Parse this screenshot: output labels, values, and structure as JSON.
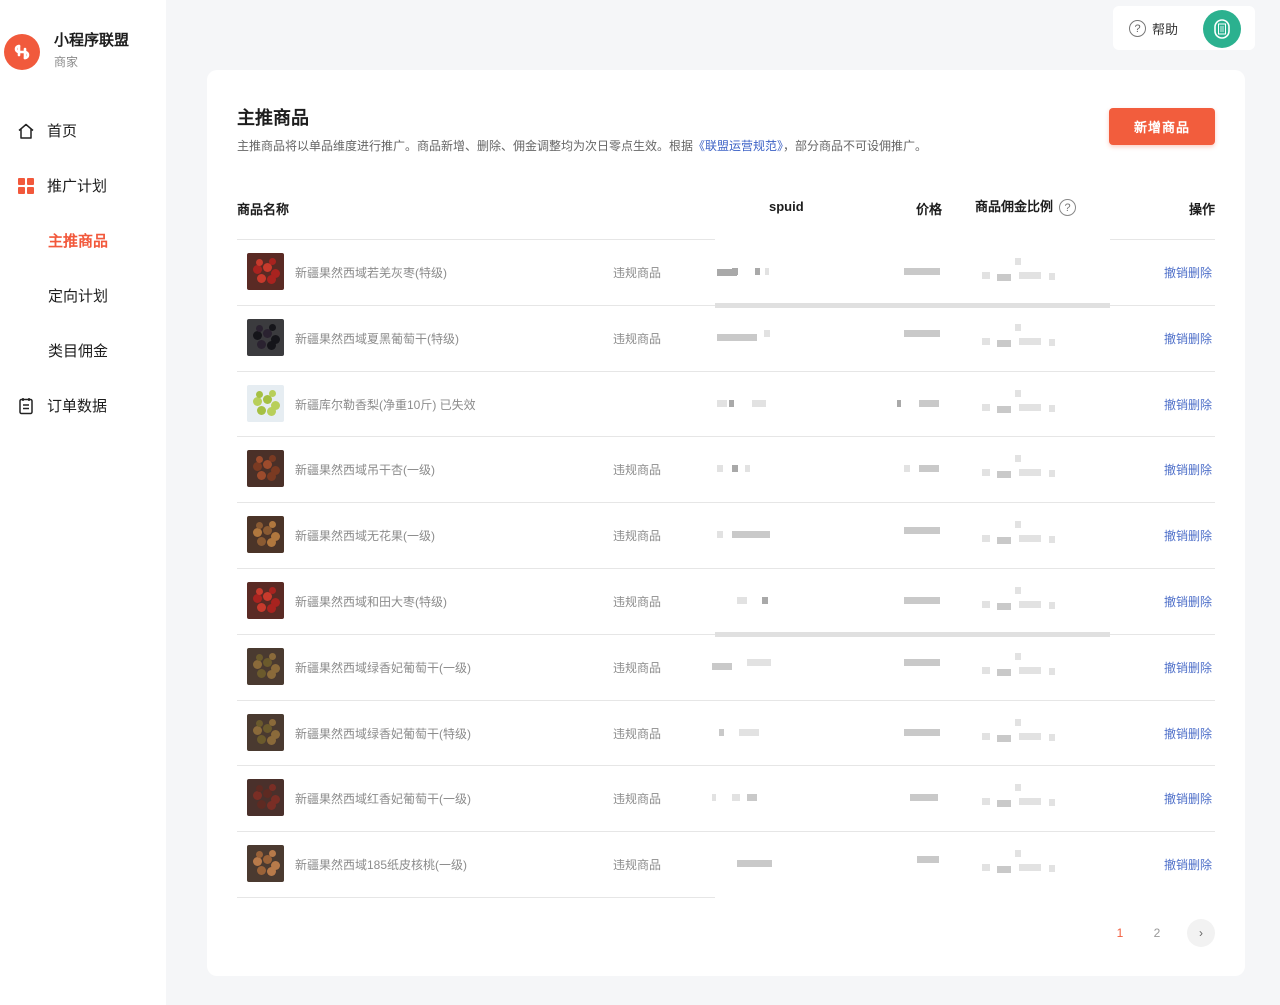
{
  "brand": {
    "name": "小程序联盟",
    "sub": "商家",
    "logo_color": "#f15a3c"
  },
  "nav": [
    {
      "label": "首页",
      "icon": "home-icon"
    },
    {
      "label": "推广计划",
      "icon": "grid-icon"
    },
    {
      "label": "主推商品",
      "active": true
    },
    {
      "label": "定向计划"
    },
    {
      "label": "类目佣金"
    },
    {
      "label": "订单数据",
      "icon": "document-icon"
    }
  ],
  "topbar": {
    "help_label": "帮助"
  },
  "page": {
    "title": "主推商品",
    "desc_before": "主推商品将以单品维度进行推广。商品新增、删除、佣金调整均为次日零点生效。根据",
    "desc_link": "《联盟运营规范》",
    "desc_after": "，部分商品不可设佣推广。",
    "add_button": "新增商品"
  },
  "table": {
    "headers": {
      "name": "商品名称",
      "spuid": "spuid",
      "price": "价格",
      "commission": "商品佣金比例",
      "action": "操作"
    },
    "rows": [
      {
        "name": "新疆果然西域若羌灰枣(特级)",
        "status": "违规商品",
        "action": "撤销删除",
        "thumb": "red-dates"
      },
      {
        "name": "新疆果然西域夏黑葡萄干(特级)",
        "status": "违规商品",
        "action": "撤销删除",
        "thumb": "black-raisins"
      },
      {
        "name": "新疆库尔勒香梨(净重10斤) 已失效",
        "status": "",
        "action": "撤销删除",
        "thumb": "pears"
      },
      {
        "name": "新疆果然西域吊干杏(一级)",
        "status": "违规商品",
        "action": "撤销删除",
        "thumb": "apricots"
      },
      {
        "name": "新疆果然西域无花果(一级)",
        "status": "违规商品",
        "action": "撤销删除",
        "thumb": "figs"
      },
      {
        "name": "新疆果然西域和田大枣(特级)",
        "status": "违规商品",
        "action": "撤销删除",
        "thumb": "red-dates"
      },
      {
        "name": "新疆果然西域绿香妃葡萄干(一级)",
        "status": "违规商品",
        "action": "撤销删除",
        "thumb": "raisins"
      },
      {
        "name": "新疆果然西域绿香妃葡萄干(特级)",
        "status": "违规商品",
        "action": "撤销删除",
        "thumb": "raisins"
      },
      {
        "name": "新疆果然西域红香妃葡萄干(一级)",
        "status": "违规商品",
        "action": "撤销删除",
        "thumb": "red-raisins"
      },
      {
        "name": "新疆果然西域185纸皮核桃(一级)",
        "status": "违规商品",
        "action": "撤销删除",
        "thumb": "walnuts"
      }
    ]
  },
  "pagination": {
    "pages": [
      "1",
      "2"
    ],
    "current": "1",
    "next": "›"
  },
  "colors": {
    "accent": "#f25d3d",
    "link": "#4e6fc9"
  }
}
